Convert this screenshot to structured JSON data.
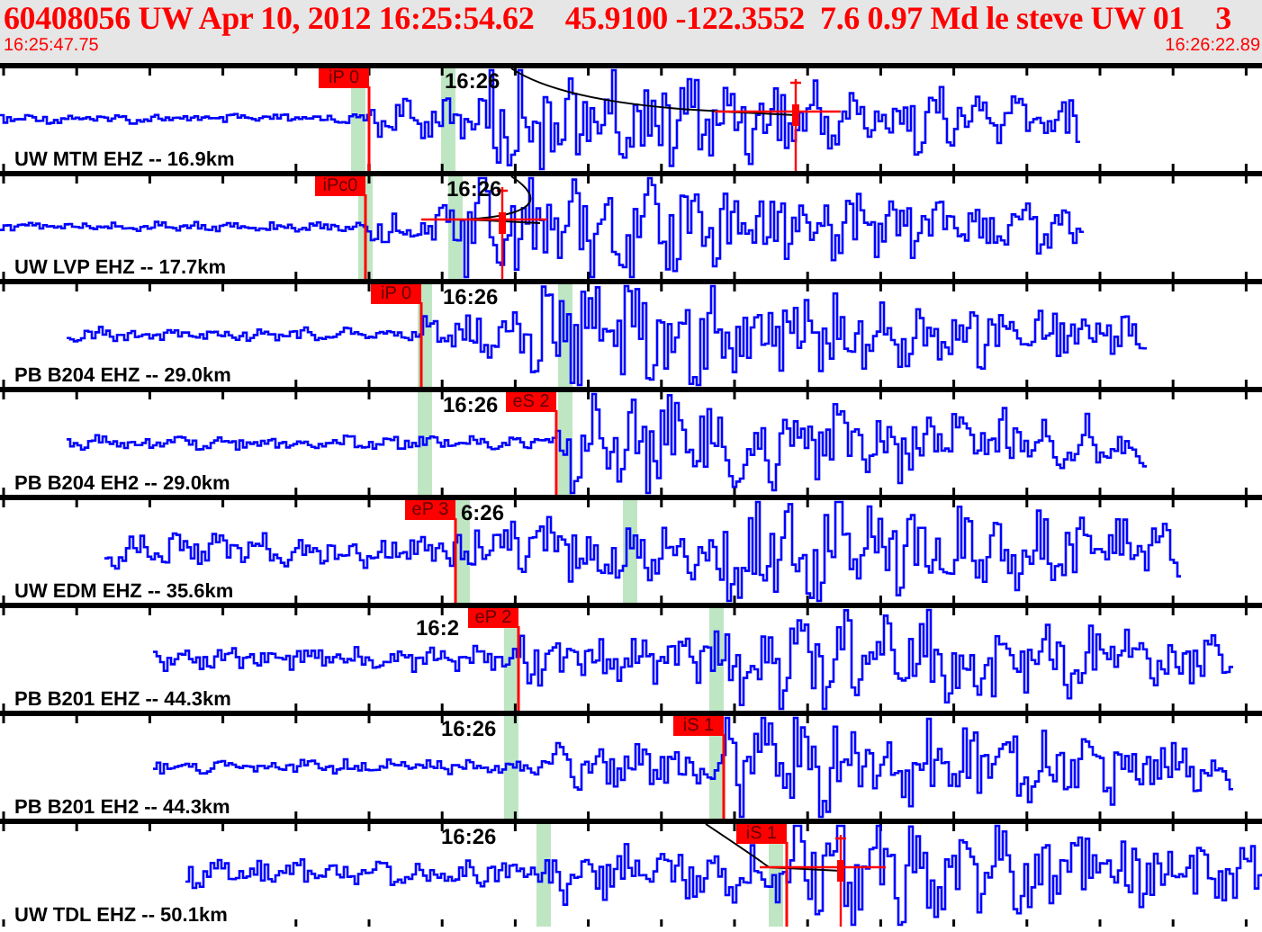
{
  "header": {
    "title": "60408056 UW Apr 10, 2012 16:25:54.62    45.9100 -122.3552  7.6 0.97 Md le steve UW 01    3",
    "start_time": "16:25:47.75",
    "end_time": "16:26:22.89"
  },
  "panels": [
    {
      "station_label": "UW MTM EHZ -- 16.9km",
      "time_label": "16:26",
      "picks": [
        {
          "label": "iP 0"
        }
      ]
    },
    {
      "station_label": "UW LVP EHZ -- 17.7km",
      "time_label": "16:26",
      "picks": [
        {
          "label": "iPc0"
        }
      ]
    },
    {
      "station_label": "PB B204 EHZ -- 29.0km",
      "time_label": "16:26",
      "picks": [
        {
          "label": "iP 0"
        }
      ]
    },
    {
      "station_label": "PB B204 EH2 -- 29.0km",
      "time_label": "16:26",
      "picks": [
        {
          "label": "eS 2"
        }
      ]
    },
    {
      "station_label": "UW EDM EHZ -- 35.6km",
      "time_label": "6:26",
      "picks": [
        {
          "label": "eP 3"
        }
      ]
    },
    {
      "station_label": "PB B201 EHZ -- 44.3km",
      "time_label": "16:2",
      "picks": [
        {
          "label": "eP 2"
        }
      ]
    },
    {
      "station_label": "PB B201 EH2 -- 44.3km",
      "time_label": "16:26",
      "picks": [
        {
          "label": "iS 1"
        }
      ]
    },
    {
      "station_label": "UW TDL EHZ -- 50.1km",
      "time_label": "16:26",
      "picks": [
        {
          "label": "iS 1"
        }
      ]
    }
  ]
}
